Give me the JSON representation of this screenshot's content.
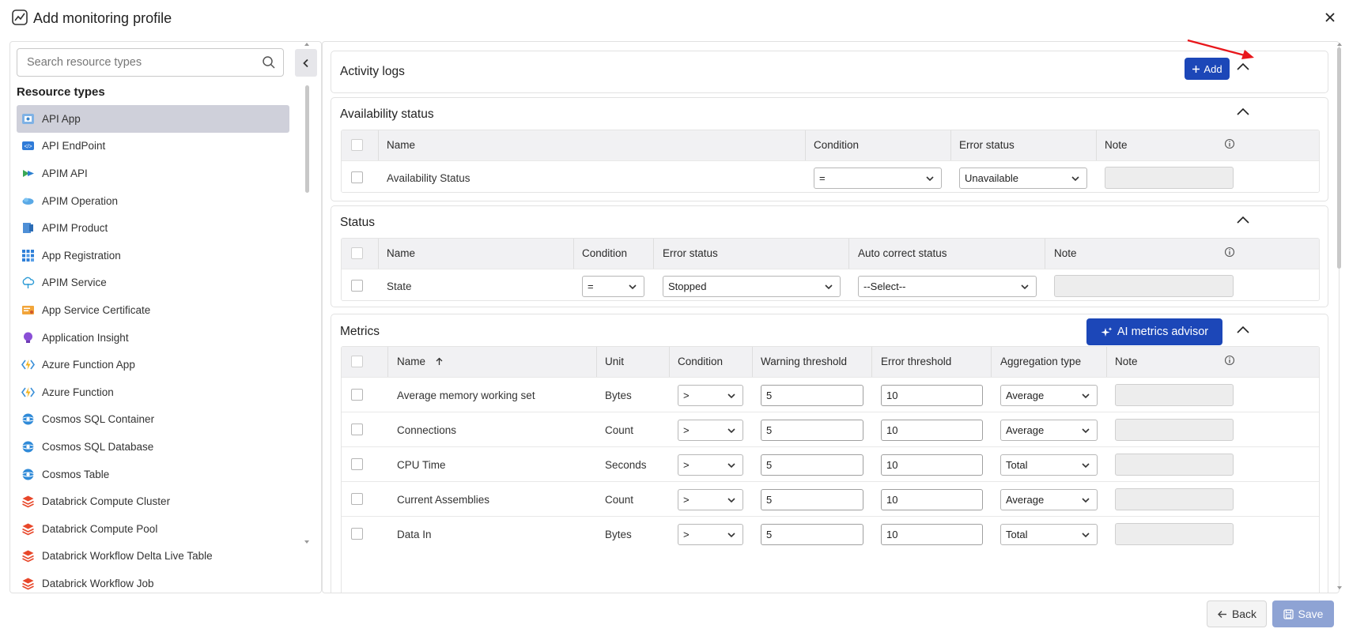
{
  "window": {
    "title": "Add monitoring profile"
  },
  "sidebar": {
    "search_placeholder": "Search resource types",
    "heading": "Resource types",
    "items": [
      {
        "label": "API App",
        "icon": "api-app-icon",
        "active": true
      },
      {
        "label": "API EndPoint",
        "icon": "api-endpoint-icon"
      },
      {
        "label": "APIM API",
        "icon": "apim-api-icon"
      },
      {
        "label": "APIM Operation",
        "icon": "apim-operation-icon"
      },
      {
        "label": "APIM Product",
        "icon": "apim-product-icon"
      },
      {
        "label": "App Registration",
        "icon": "app-registration-icon"
      },
      {
        "label": "APIM Service",
        "icon": "apim-service-icon"
      },
      {
        "label": "App Service Certificate",
        "icon": "certificate-icon"
      },
      {
        "label": "Application Insight",
        "icon": "application-insight-icon"
      },
      {
        "label": "Azure Function App",
        "icon": "function-app-icon"
      },
      {
        "label": "Azure Function",
        "icon": "function-icon"
      },
      {
        "label": "Cosmos SQL Container",
        "icon": "cosmos-icon"
      },
      {
        "label": "Cosmos SQL Database",
        "icon": "cosmos-icon"
      },
      {
        "label": "Cosmos Table",
        "icon": "cosmos-icon"
      },
      {
        "label": "Databrick Compute Cluster",
        "icon": "databricks-icon"
      },
      {
        "label": "Databrick Compute Pool",
        "icon": "databricks-icon"
      },
      {
        "label": "Databrick Workflow Delta Live Table",
        "icon": "databricks-icon"
      },
      {
        "label": "Databrick Workflow Job",
        "icon": "databricks-icon"
      }
    ]
  },
  "activity_logs": {
    "title": "Activity logs",
    "add_label": "Add"
  },
  "availability": {
    "title": "Availability status",
    "headers": {
      "name": "Name",
      "condition": "Condition",
      "error_status": "Error status",
      "note": "Note"
    },
    "rows": [
      {
        "name": "Availability Status",
        "condition": "=",
        "error_status": "Unavailable",
        "note": ""
      }
    ]
  },
  "status": {
    "title": "Status",
    "headers": {
      "name": "Name",
      "condition": "Condition",
      "error_status": "Error status",
      "auto_correct": "Auto correct status",
      "note": "Note"
    },
    "rows": [
      {
        "name": "State",
        "condition": "=",
        "error_status": "Stopped",
        "auto_correct": "--Select--",
        "note": ""
      }
    ]
  },
  "metrics": {
    "title": "Metrics",
    "ai_label": "AI metrics advisor",
    "headers": {
      "name": "Name",
      "unit": "Unit",
      "condition": "Condition",
      "warning": "Warning threshold",
      "error": "Error threshold",
      "aggregation": "Aggregation type",
      "note": "Note"
    },
    "rows": [
      {
        "name": "Average memory working set",
        "unit": "Bytes",
        "condition": ">",
        "warning": "5",
        "error": "10",
        "aggregation": "Average"
      },
      {
        "name": "Connections",
        "unit": "Count",
        "condition": ">",
        "warning": "5",
        "error": "10",
        "aggregation": "Average"
      },
      {
        "name": "CPU Time",
        "unit": "Seconds",
        "condition": ">",
        "warning": "5",
        "error": "10",
        "aggregation": "Total"
      },
      {
        "name": "Current Assemblies",
        "unit": "Count",
        "condition": ">",
        "warning": "5",
        "error": "10",
        "aggregation": "Average"
      },
      {
        "name": "Data In",
        "unit": "Bytes",
        "condition": ">",
        "warning": "5",
        "error": "10",
        "aggregation": "Total"
      }
    ]
  },
  "footer": {
    "back_label": "Back",
    "save_label": "Save"
  },
  "colors": {
    "primary": "#1c47b8",
    "save_disabled": "#8ea3d4",
    "active_item": "#cfd0da",
    "annotation_arrow": "#e8161b"
  }
}
